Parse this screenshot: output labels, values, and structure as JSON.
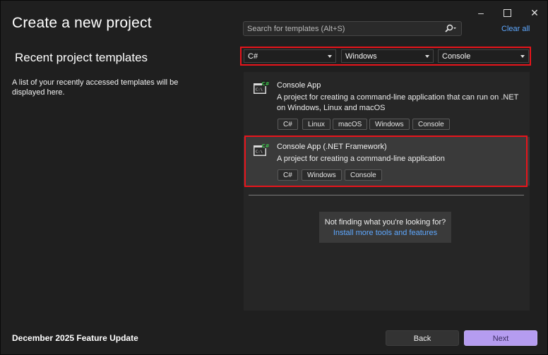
{
  "window": {
    "title": "Create a new project",
    "controls": {
      "minimize": "–",
      "maximize": "☐",
      "close": "✕"
    }
  },
  "recent": {
    "heading": "Recent project templates",
    "description": "A list of your recently accessed templates will be displayed here."
  },
  "search": {
    "placeholder": "Search for templates (Alt+S)",
    "icon": "search-icon",
    "clear_label": "Clear all"
  },
  "filters": {
    "language": "C#",
    "platform": "Windows",
    "project_type": "Console"
  },
  "templates": [
    {
      "title": "Console App",
      "description": "A project for creating a command-line application that can run on .NET on Windows, Linux and macOS",
      "tags": [
        "C#",
        "Linux",
        "macOS",
        "Windows",
        "Console"
      ],
      "icon_badge": "C#",
      "icon_text": "C:\\"
    },
    {
      "title": "Console App (.NET Framework)",
      "description": "A project for creating a command-line application",
      "tags": [
        "C#",
        "Windows",
        "Console"
      ],
      "icon_badge": "C#",
      "icon_text": "C:\\"
    }
  ],
  "not_found": {
    "text": "Not finding what you're looking for?",
    "link": "Install more tools and features"
  },
  "footer": {
    "update_text": "December 2025 Feature Update",
    "back_label": "Back",
    "next_label": "Next"
  },
  "colors": {
    "highlight_outline": "#e8141b",
    "link": "#5ea8ff",
    "next_button": "#b59cf0"
  }
}
